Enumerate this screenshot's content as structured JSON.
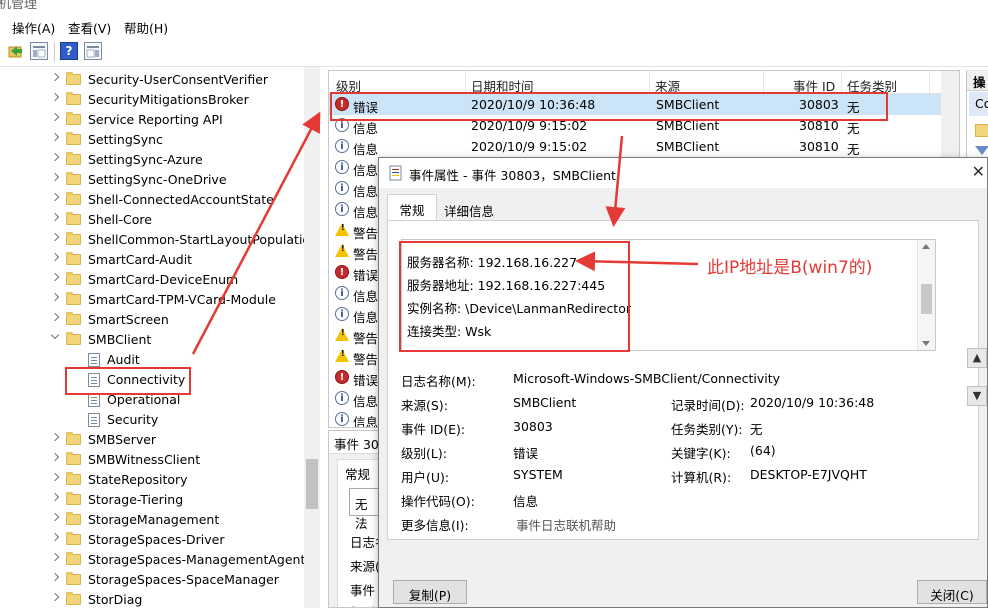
{
  "window": {
    "title_fragment": "机管理"
  },
  "menu": {
    "items": [
      "操作(A)",
      "查看(V)",
      "帮助(H)"
    ]
  },
  "toolbar": {
    "icons": [
      "back-arrow-icon",
      "show-hide-tree-icon",
      "help-icon",
      "properties-icon"
    ]
  },
  "tree": {
    "items": [
      {
        "label": "Security-UserConsentVerifier",
        "kind": "folder",
        "expander": "collapsed"
      },
      {
        "label": "SecurityMitigationsBroker",
        "kind": "folder",
        "expander": "collapsed"
      },
      {
        "label": "Service Reporting API",
        "kind": "folder",
        "expander": "collapsed"
      },
      {
        "label": "SettingSync",
        "kind": "folder",
        "expander": "collapsed"
      },
      {
        "label": "SettingSync-Azure",
        "kind": "folder",
        "expander": "collapsed"
      },
      {
        "label": "SettingSync-OneDrive",
        "kind": "folder",
        "expander": "collapsed"
      },
      {
        "label": "Shell-ConnectedAccountState",
        "kind": "folder",
        "expander": "collapsed"
      },
      {
        "label": "Shell-Core",
        "kind": "folder",
        "expander": "collapsed"
      },
      {
        "label": "ShellCommon-StartLayoutPopulation",
        "kind": "folder",
        "expander": "collapsed"
      },
      {
        "label": "SmartCard-Audit",
        "kind": "folder",
        "expander": "collapsed"
      },
      {
        "label": "SmartCard-DeviceEnum",
        "kind": "folder",
        "expander": "collapsed"
      },
      {
        "label": "SmartCard-TPM-VCard-Module",
        "kind": "folder",
        "expander": "collapsed"
      },
      {
        "label": "SmartScreen",
        "kind": "folder",
        "expander": "collapsed"
      },
      {
        "label": "SMBClient",
        "kind": "folder",
        "expander": "expanded"
      },
      {
        "label": "Audit",
        "kind": "log",
        "expander": "none"
      },
      {
        "label": "Connectivity",
        "kind": "log",
        "expander": "none",
        "selected": true
      },
      {
        "label": "Operational",
        "kind": "log",
        "expander": "none"
      },
      {
        "label": "Security",
        "kind": "log",
        "expander": "none"
      },
      {
        "label": "SMBServer",
        "kind": "folder",
        "expander": "collapsed"
      },
      {
        "label": "SMBWitnessClient",
        "kind": "folder",
        "expander": "collapsed"
      },
      {
        "label": "StateRepository",
        "kind": "folder",
        "expander": "collapsed"
      },
      {
        "label": "Storage-Tiering",
        "kind": "folder",
        "expander": "collapsed"
      },
      {
        "label": "StorageManagement",
        "kind": "folder",
        "expander": "collapsed"
      },
      {
        "label": "StorageSpaces-Driver",
        "kind": "folder",
        "expander": "collapsed"
      },
      {
        "label": "StorageSpaces-ManagementAgent",
        "kind": "folder",
        "expander": "collapsed"
      },
      {
        "label": "StorageSpaces-SpaceManager",
        "kind": "folder",
        "expander": "collapsed"
      },
      {
        "label": "StorDiag",
        "kind": "folder",
        "expander": "collapsed"
      }
    ]
  },
  "event_list": {
    "headers": [
      "级别",
      "日期和时间",
      "来源",
      "事件 ID",
      "任务类别"
    ],
    "rows": [
      {
        "level": "错误",
        "icon": "error-icon",
        "datetime": "2020/10/9 10:36:48",
        "source": "SMBClient",
        "event_id": "30803",
        "category": "无",
        "selected": true
      },
      {
        "level": "信息",
        "icon": "info-icon",
        "datetime": "2020/10/9 9:15:02",
        "source": "SMBClient",
        "event_id": "30810",
        "category": "无"
      },
      {
        "level": "信息",
        "icon": "info-icon",
        "datetime": "2020/10/9 9:15:02",
        "source": "SMBClient",
        "event_id": "30810",
        "category": "无"
      },
      {
        "level": "信息",
        "icon": "info-icon"
      },
      {
        "level": "信息",
        "icon": "info-icon"
      },
      {
        "level": "信息",
        "icon": "info-icon"
      },
      {
        "level": "警告",
        "icon": "warning-icon"
      },
      {
        "level": "警告",
        "icon": "warning-icon"
      },
      {
        "level": "错误",
        "icon": "error-icon"
      },
      {
        "level": "信息",
        "icon": "info-icon"
      },
      {
        "level": "信息",
        "icon": "info-icon"
      },
      {
        "level": "警告",
        "icon": "warning-icon"
      },
      {
        "level": "警告",
        "icon": "warning-icon"
      },
      {
        "level": "错误",
        "icon": "error-icon"
      },
      {
        "level": "信息",
        "icon": "info-icon"
      },
      {
        "level": "信息",
        "icon": "info-icon"
      }
    ]
  },
  "lower_pane": {
    "title_partial": "事件 30",
    "tab_partial": "常规",
    "field_partial": "无法",
    "labels_partial": [
      "日志名",
      "来源(",
      "事件",
      "级别"
    ]
  },
  "actions_pane": {
    "header_partial": "操",
    "item_partial": "Co"
  },
  "dialog": {
    "title": "事件属性 - 事件 30803，SMBClient",
    "close_glyph": "✕",
    "tabs": [
      "常规",
      "详细信息"
    ],
    "description_lines": [
      "服务器名称: 192.168.16.227",
      "服务器地址: 192.168.16.227:445",
      "实例名称: \\Device\\LanmanRedirector",
      "连接类型: Wsk"
    ],
    "props": {
      "log_name_label": "日志名称(M):",
      "log_name": "Microsoft-Windows-SMBClient/Connectivity",
      "source_label": "来源(S):",
      "source": "SMBClient",
      "logged_label": "记录时间(D):",
      "logged": "2020/10/9 10:36:48",
      "event_id_label": "事件 ID(E):",
      "event_id": "30803",
      "task_label": "任务类别(Y):",
      "task": "无",
      "level_label": "级别(L):",
      "level": "错误",
      "keywords_label": "关键字(K):",
      "keywords": "(64)",
      "user_label": "用户(U):",
      "user": "SYSTEM",
      "computer_label": "计算机(R):",
      "computer": "DESKTOP-E7JVQHT",
      "opcode_label": "操作代码(O):",
      "opcode": "信息",
      "more_info_label": "更多信息(I):",
      "more_info": "事件日志联机帮助"
    },
    "copy_button": "复制(P)",
    "close_button": "关闭(C)",
    "prev_icon": "up-arrow-icon",
    "next_icon": "down-arrow-icon"
  },
  "annotation": {
    "text": "此IP地址是B(win7的)",
    "color": "#e53935"
  },
  "colors": {
    "selection": "#cce4f7",
    "accent": "#2c4f9e",
    "error": "#c62a2a",
    "warning": "#f3c200"
  }
}
